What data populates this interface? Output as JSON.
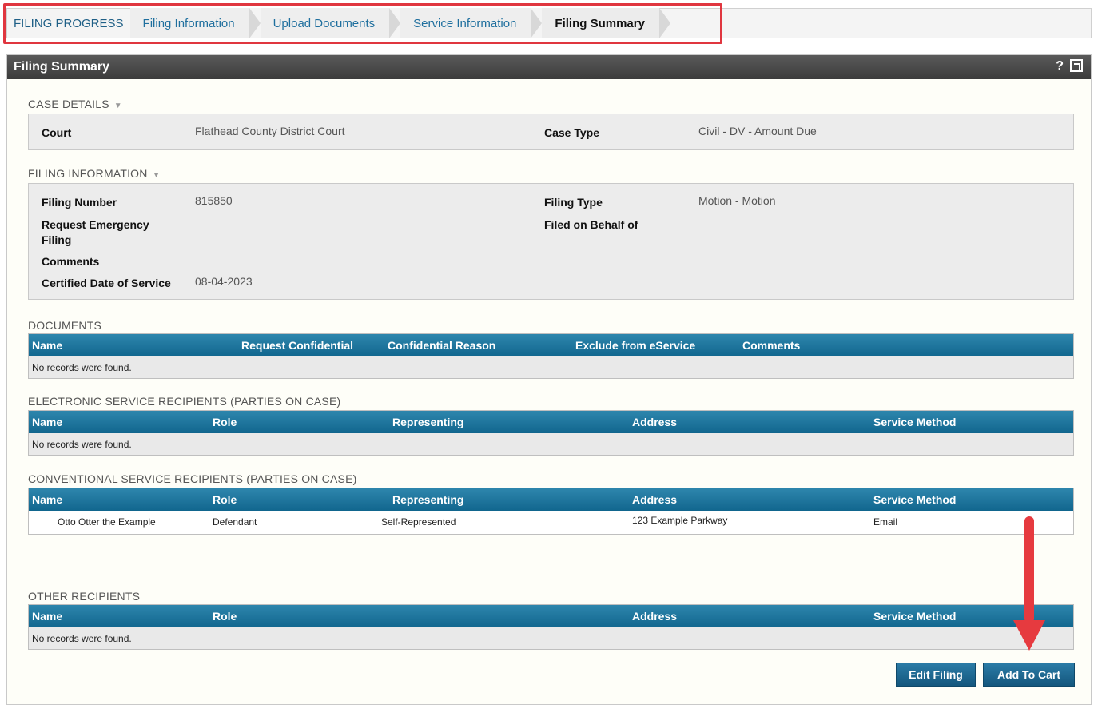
{
  "progress": {
    "label": "FILING PROGRESS",
    "steps": [
      "Filing Information",
      "Upload Documents",
      "Service Information",
      "Filing Summary"
    ],
    "active": "Filing Summary"
  },
  "panel": {
    "title": "Filing Summary",
    "help": "?"
  },
  "case_details": {
    "title": "CASE DETAILS",
    "court_label": "Court",
    "court_value": "Flathead County District Court",
    "case_type_label": "Case Type",
    "case_type_value": "Civil - DV - Amount Due"
  },
  "filing_information": {
    "title": "FILING INFORMATION",
    "filing_number_label": "Filing Number",
    "filing_number_value": "815850",
    "emergency_label_1": "Request Emergency",
    "emergency_label_2": "Filing",
    "comments_label": "Comments",
    "cert_date_label": "Certified Date of Service",
    "cert_date_value": "08-04-2023",
    "filing_type_label": "Filing Type",
    "filing_type_value": "Motion - Motion",
    "behalf_label": "Filed on Behalf of"
  },
  "documents": {
    "title": "DOCUMENTS",
    "headers": [
      "Name",
      "Request Confidential",
      "Confidential Reason",
      "Exclude from eService",
      "Comments"
    ],
    "empty": "No records were found."
  },
  "electronic": {
    "title": "ELECTRONIC SERVICE RECIPIENTS (PARTIES ON CASE)",
    "headers": [
      "Name",
      "Role",
      "Representing",
      "Address",
      "Service Method"
    ],
    "empty": "No records were found."
  },
  "conventional": {
    "title": "CONVENTIONAL SERVICE RECIPIENTS (PARTIES ON CASE)",
    "headers": [
      "Name",
      "Role",
      "Representing",
      "Address",
      "Service Method"
    ],
    "rows": [
      [
        "Otto Otter the Example",
        "Defendant",
        "Self-Represented",
        "123 Example Parkway",
        "Email"
      ]
    ]
  },
  "other": {
    "title": "OTHER RECIPIENTS",
    "headers": [
      "Name",
      "Role",
      "Address",
      "Service Method"
    ],
    "empty": "No records were found."
  },
  "buttons": {
    "edit": "Edit Filing",
    "add": "Add To Cart"
  },
  "colors": {
    "annotation_red": "#e63a3f",
    "header_blue": "#11668e"
  }
}
